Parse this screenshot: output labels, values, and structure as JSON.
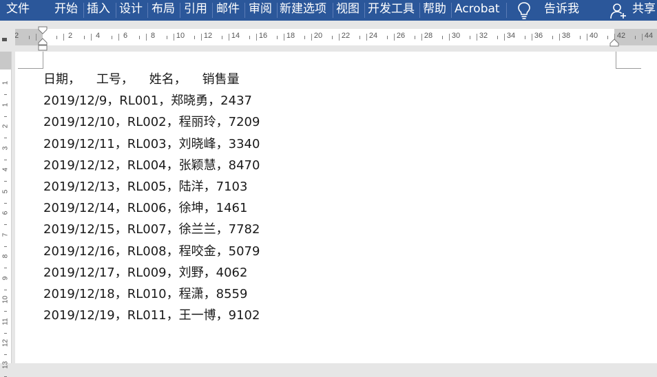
{
  "ribbon": {
    "tabs": [
      "文件",
      "开始",
      "插入",
      "设计",
      "布局",
      "引用",
      "邮件",
      "审阅",
      "新建选项",
      "视图",
      "开发工具",
      "帮助",
      "Acrobat"
    ],
    "tell_me": "告诉我",
    "share": "共享",
    "background_color": "#2b579a"
  },
  "ruler": {
    "horizontal_labels": [
      "2",
      "2",
      "4",
      "6",
      "8",
      "10",
      "12",
      "14",
      "16",
      "18",
      "20",
      "22",
      "24",
      "26",
      "28",
      "30",
      "32",
      "34",
      "36",
      "38",
      "40",
      "42",
      "44"
    ],
    "vertical_labels": [
      "1",
      "1",
      "2",
      "3",
      "4",
      "5",
      "6",
      "7",
      "8",
      "9",
      "10",
      "11",
      "12",
      "13"
    ]
  },
  "document": {
    "lines": [
      "日期，    工号，    姓名，    销售量",
      "2019/12/9，RL001，郑晓勇，2437",
      "2019/12/10，RL002，程丽玲，7209",
      "2019/12/11，RL003，刘晓峰，3340",
      "2019/12/12，RL004，张颖慧，8470",
      "2019/12/13，RL005，陆洋，7103",
      "2019/12/14，RL006，徐坤，1461",
      "2019/12/15，RL007，徐兰兰，7782",
      "2019/12/16，RL008，程咬金，5079",
      "2019/12/17，RL009，刘野，4062",
      "2019/12/18，RL010，程潇，8559",
      "2019/12/19，RL011，王一博，9102"
    ]
  }
}
